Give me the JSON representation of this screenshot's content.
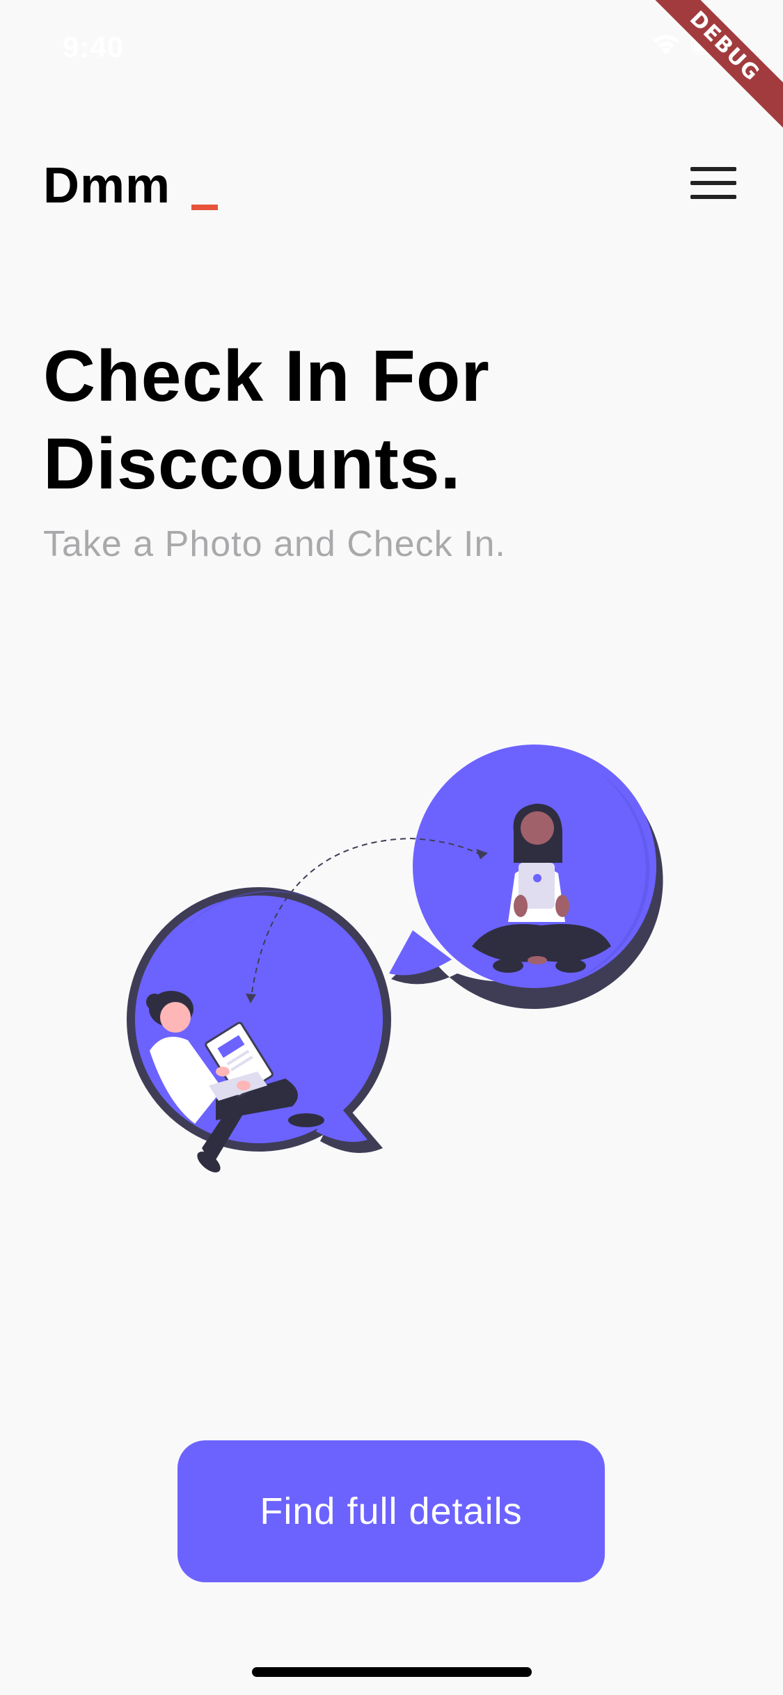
{
  "status_bar": {
    "time": "9:40",
    "icons": [
      "wifi-icon",
      "battery-icon"
    ]
  },
  "debug_banner": {
    "label": "DEBUG",
    "color": "#a23b3d"
  },
  "app_bar": {
    "brand": "Dmm",
    "cursor_color": "#e6543b",
    "menu_icon": "hamburger-menu-icon"
  },
  "hero": {
    "title_line1": "Check In For",
    "title_line2": "Disccounts.",
    "subtitle": "Take a Photo and Check In."
  },
  "illustration": {
    "description_icon": "chat-bubbles-illustration",
    "accent_color": "#6c63ff",
    "outline_color": "#3f3d56"
  },
  "cta": {
    "label": "Find full details",
    "color": "#6c63ff"
  }
}
